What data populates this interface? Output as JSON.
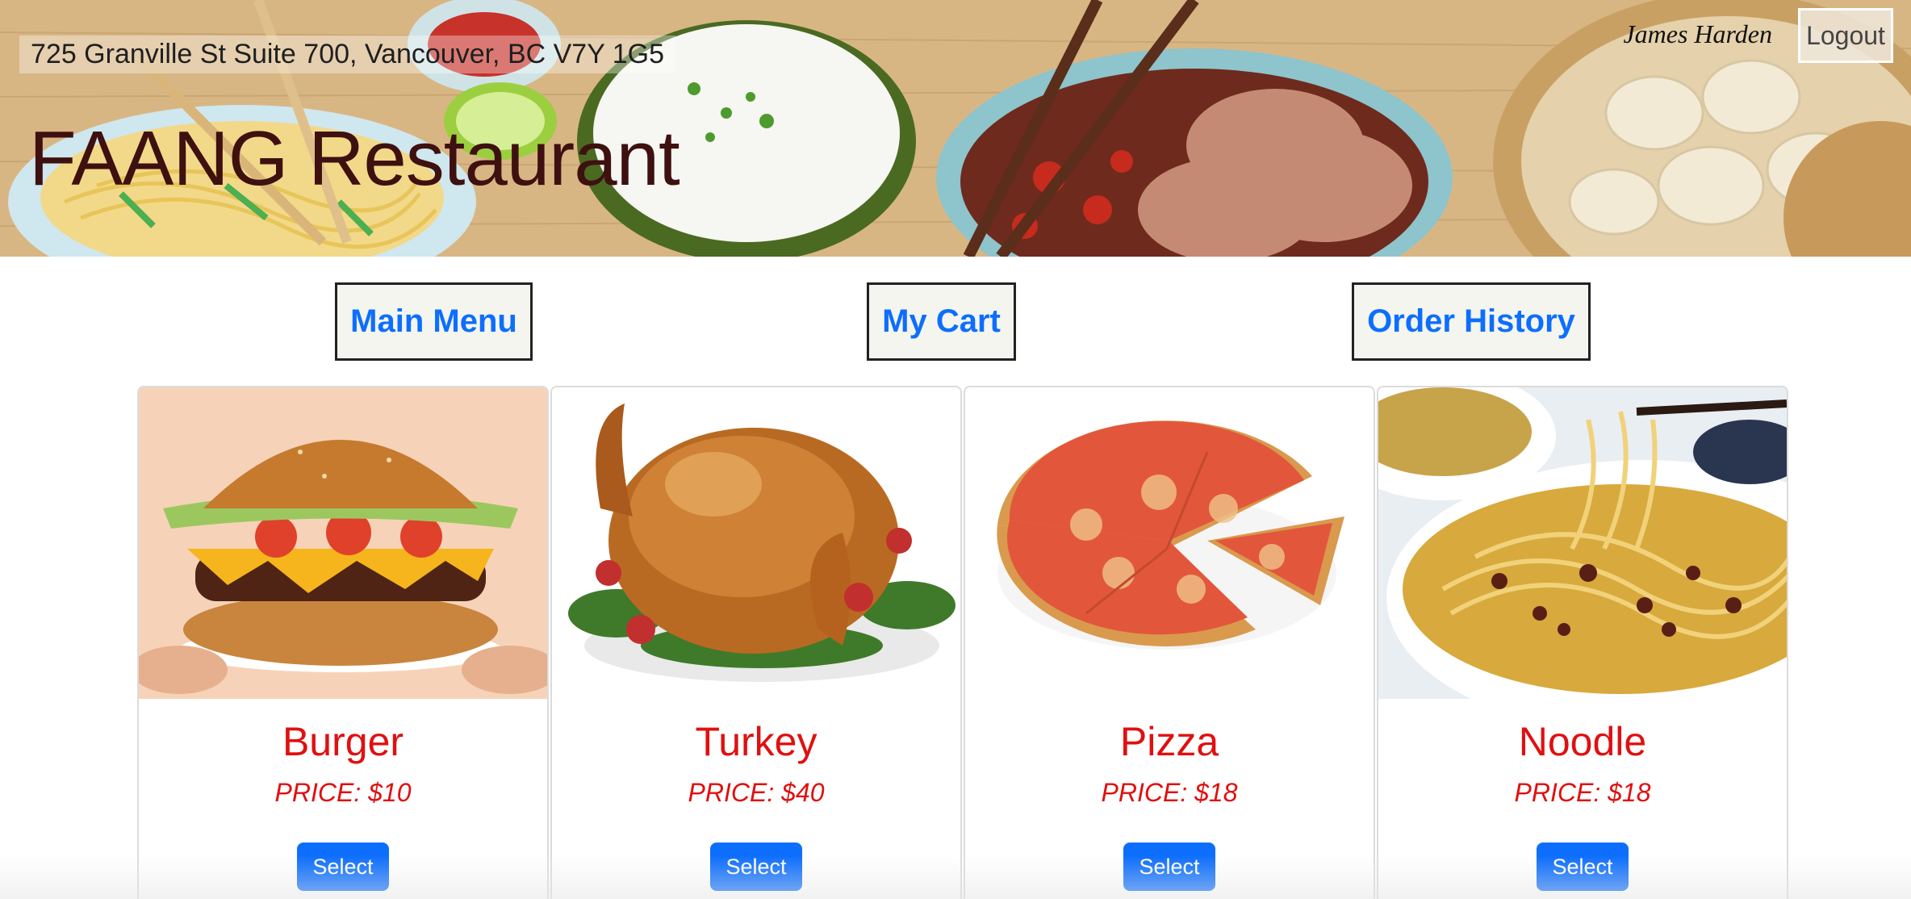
{
  "header": {
    "address": "725 Granville St Suite 700, Vancouver, BC V7Y 1G5",
    "restaurant_name": "FAANG Restaurant",
    "user_name": "James Harden",
    "logout_label": "Logout"
  },
  "nav": {
    "main_menu": "Main Menu",
    "my_cart": "My Cart",
    "order_history": "Order History"
  },
  "menu_items": [
    {
      "name": "Burger",
      "price": "PRICE: $10",
      "select_label": "Select"
    },
    {
      "name": "Turkey",
      "price": "PRICE: $40",
      "select_label": "Select"
    },
    {
      "name": "Pizza",
      "price": "PRICE: $18",
      "select_label": "Select"
    },
    {
      "name": "Noodle",
      "price": "PRICE: $18",
      "select_label": "Select"
    }
  ],
  "colors": {
    "link_blue": "#0d6efd",
    "price_red": "#e01010",
    "title_maroon": "#3e1010"
  }
}
